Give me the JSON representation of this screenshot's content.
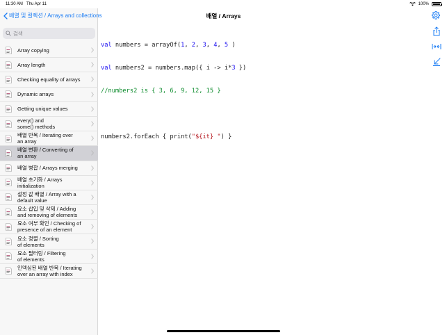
{
  "status": {
    "time": "11:30 AM",
    "date": "Thu Apr 11",
    "battery": "100%"
  },
  "sidebar": {
    "back_label": "배열 및 컬렉션 / Arrays and collections",
    "search_placeholder": "검색",
    "items": [
      {
        "label_l1": "Array copying",
        "label_l2": ""
      },
      {
        "label_l1": "Array length",
        "label_l2": ""
      },
      {
        "label_l1": "Checking equality of arrays",
        "label_l2": ""
      },
      {
        "label_l1": "Dynamic arrays",
        "label_l2": ""
      },
      {
        "label_l1": "Getting unique values",
        "label_l2": ""
      },
      {
        "label_l1": "every() and",
        "label_l2": "some() methods"
      },
      {
        "label_l1": "배열 반복 / Iterating over",
        "label_l2": "an array"
      },
      {
        "label_l1": "배열 변환 / Converting of",
        "label_l2": "an array",
        "selected": true
      },
      {
        "label_l1": "배열 병합 / Arrays merging",
        "label_l2": ""
      },
      {
        "label_l1": "배열 초기화 / Arrays",
        "label_l2": "initialization"
      },
      {
        "label_l1": "설정 값 배열 / Array with a",
        "label_l2": "default value"
      },
      {
        "label_l1": "요소 삽입 및 삭제 / Adding",
        "label_l2": "and removing of elements"
      },
      {
        "label_l1": "요소 여부 확인 / Checking of",
        "label_l2": "presence of an element"
      },
      {
        "label_l1": "요소 정렬 / Sorting",
        "label_l2": "of elements"
      },
      {
        "label_l1": "요소 필터링 / Filtering",
        "label_l2": "of elements"
      },
      {
        "label_l1": "인덱싱된 배열 반복 / Iterating",
        "label_l2": "over an array with index"
      }
    ]
  },
  "main": {
    "title": "배열 / Arrays",
    "code": {
      "l1": {
        "kw": "val",
        "text": " numbers = arrayOf(",
        "n1": "1",
        "c1": ", ",
        "n2": "2",
        "c2": ", ",
        "n3": "3",
        "c3": ", ",
        "n4": "4",
        "c4": ", ",
        "n5": "5",
        "end": " )"
      },
      "l2": {
        "kw": "val",
        "text": " numbers2 = numbers.map({ i -> i*",
        "n": "3",
        "end": " })"
      },
      "l3": "//numbers2 is { 3, 6, 9, 12, 15 }",
      "l5": {
        "text": "numbers2.forEach { print(",
        "str": "\"${it} \"",
        "end": ") }"
      }
    }
  },
  "colors": {
    "accent": "#1a7cf4",
    "keyword": "#1a0df0",
    "comment": "#0a8a2a",
    "string": "#b3121a",
    "selected_row": "#d1d1d6"
  },
  "icons": [
    "back-chevron-icon",
    "search-icon",
    "document-icon",
    "chevron-right-icon",
    "gear-icon",
    "share-icon",
    "collapse-icon",
    "shrink-icon",
    "wifi-icon",
    "battery-icon"
  ]
}
